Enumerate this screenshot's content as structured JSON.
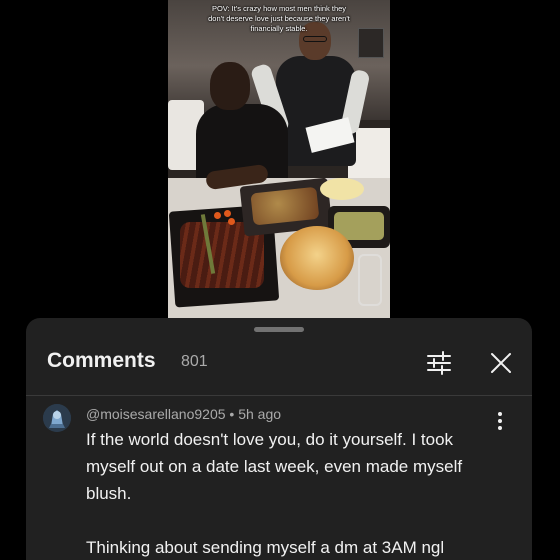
{
  "video": {
    "caption": "POV: It's crazy how most men think they don't deserve love just because they aren't financially stable."
  },
  "comments_panel": {
    "title": "Comments",
    "count": "801",
    "filter_icon": "sort-filter-icon",
    "close_icon": "close-icon"
  },
  "comment": {
    "author": "@moisesarellano9205",
    "separator": " • ",
    "time": "5h ago",
    "text": "If the world doesn't love you, do it yourself. I took myself out on a date last week, even made myself blush.\n\nThinking about sending myself a dm at 3AM ngl",
    "avatar_icon": "avatar-icon",
    "menu_icon": "more-vertical-icon"
  },
  "colors": {
    "background": "#000000",
    "sheet": "#212121",
    "text_primary": "#f1f1f1",
    "text_secondary": "#aaaaaa"
  }
}
